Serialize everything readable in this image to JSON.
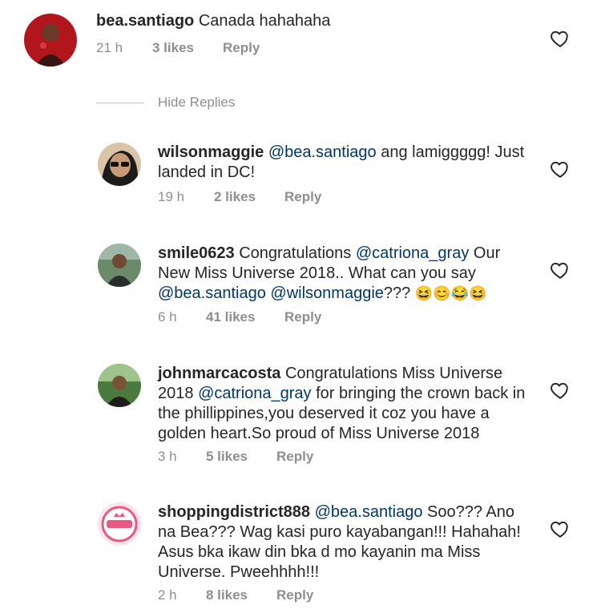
{
  "top_comment": {
    "username": "bea.santiago",
    "text": "Canada hahahaha",
    "time": "21 h",
    "likes": "3 likes",
    "reply": "Reply"
  },
  "hide_replies": "Hide Replies",
  "replies": [
    {
      "username": "wilsonmaggie",
      "mention": "@bea.santiago",
      "text": " ang lamiggggg! Just landed in DC!",
      "time": "19 h",
      "likes": "2 likes",
      "reply": "Reply"
    },
    {
      "username": "smile0623",
      "text_a": " Congratulations ",
      "mention_a": "@catriona_gray",
      "text_b": " Our New Miss Universe 2018.. What can you say ",
      "mention_b": "@bea.santiago",
      "mention_c": "@wilsonmaggie",
      "text_c": "??? ",
      "emojis": "😆😊😂😆",
      "time": "6 h",
      "likes": "41 likes",
      "reply": "Reply"
    },
    {
      "username": "johnmarcacosta",
      "text_a": " Congratulations Miss Universe 2018 ",
      "mention_a": "@catriona_gray",
      "text_b": " for bringing the crown back in the phillippines,you deserved it coz you have a golden heart.So proud of Miss Universe 2018",
      "time": "3 h",
      "likes": "5 likes",
      "reply": "Reply"
    },
    {
      "username": "shoppingdistrict888",
      "mention": "@bea.santiago",
      "text": " Soo??? Ano na Bea??? Wag kasi puro kayabangan!!! Hahahah! Asus bka ikaw din bka d mo kayanin ma Miss Universe. Pweehhhh!!!",
      "time": "2 h",
      "likes": "8 likes",
      "reply": "Reply"
    }
  ]
}
